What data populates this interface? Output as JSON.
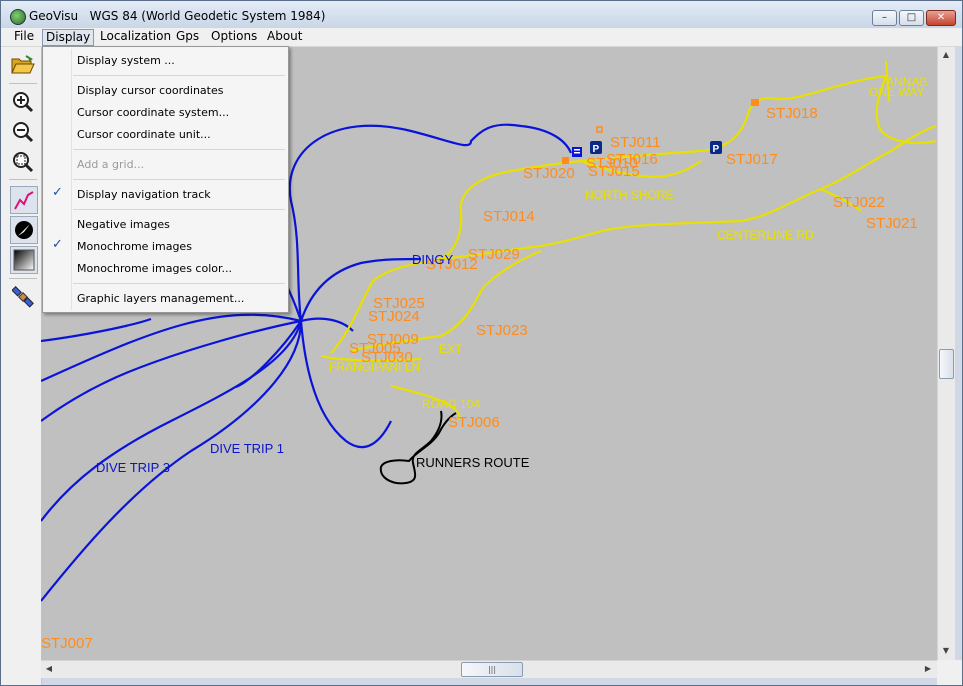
{
  "window": {
    "title": "GeoVisu   WGS 84 (World Geodetic System 1984)",
    "min_glyph": "–",
    "max_glyph": "□",
    "close_glyph": "✕"
  },
  "menu": {
    "file": "File",
    "display": "Display",
    "localization": "Localization",
    "gps": "Gps",
    "options": "Options",
    "about": "About"
  },
  "display_menu": {
    "display_system": "Display system ...",
    "display_cursor_coordinates": "Display cursor coordinates",
    "cursor_coordinate_system": "Cursor coordinate system...",
    "cursor_coordinate_unit": "Cursor coordinate unit...",
    "add_grid": "Add a grid...",
    "display_navigation_track": "Display navigation track",
    "navigation_track_checked": true,
    "negative_images": "Negative images",
    "monochrome_images": "Monochrome images",
    "monochrome_images_checked": true,
    "monochrome_images_color": "Monochrome images color...",
    "graphic_layers_management": "Graphic layers management...",
    "check_glyph": "✓"
  },
  "toolbar": {
    "icons": [
      "open-folder-icon",
      "zoom-in-icon",
      "zoom-out-icon",
      "zoom-fit-icon",
      "navigation-track-icon",
      "north-arrow-icon",
      "monochrome-gradient-icon",
      "satellite-icon"
    ]
  },
  "scrollbars": {
    "up_glyph": "▲",
    "down_glyph": "▼",
    "left_glyph": "◀",
    "right_glyph": "▶",
    "grip_glyph": "|||"
  },
  "map": {
    "colors": {
      "background": "#c0c0c0",
      "road": "#e8e000",
      "dive_track": "#0a14d8",
      "run_track": "#000000",
      "waypoint": "#ff8c1a",
      "label_blue": "#0a14c8"
    },
    "waypoints": [
      "STJ011",
      "STJ016",
      "STJ015",
      "STJ020",
      "STJ010",
      "STJ017",
      "STJ018",
      "STJ022",
      "STJ021",
      "STJ014",
      "STJ029",
      "STJ012",
      "STJ025",
      "STJ024",
      "STJ009",
      "STJ005",
      "STJ030",
      "STJ023",
      "STJ006",
      "STJ007"
    ],
    "road_labels": [
      "ANNAB",
      "ONE WAY",
      "NORTH SHORE",
      "CENTERLINE RD",
      "EXT",
      "FRANGIPANI LN",
      "ROAD 104"
    ],
    "track_labels": [
      "DINGY",
      "DIVE TRIP 1",
      "DIVE TRIP 3",
      "RUNNERS ROUTE"
    ],
    "parking_glyph": "P"
  }
}
